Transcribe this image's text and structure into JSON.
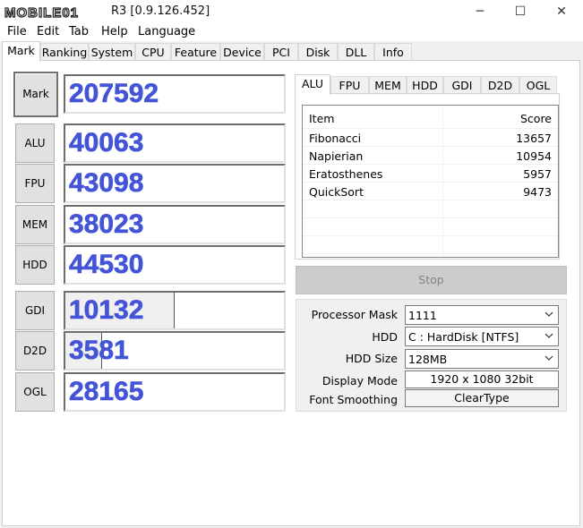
{
  "window": {
    "logo_text": "MOBILE01",
    "title": "R3 [0.9.126.452]",
    "minimize": "─",
    "maximize": "☐",
    "close": "✕"
  },
  "menu": [
    "File",
    "Edit",
    "Tab",
    "Help",
    "Language"
  ],
  "main_tabs": [
    "Mark",
    "Ranking",
    "System",
    "CPU",
    "Feature",
    "Device",
    "PCI",
    "Disk",
    "DLL",
    "Info"
  ],
  "active_main_tab": "Mark",
  "scores": [
    {
      "label": "Mark",
      "value": "207592"
    },
    {
      "label": "ALU",
      "value": "40063"
    },
    {
      "label": "FPU",
      "value": "43098"
    },
    {
      "label": "MEM",
      "value": "38023"
    },
    {
      "label": "HDD",
      "value": "44530"
    },
    {
      "label": "GDI",
      "value": "10132",
      "level": 0.5
    },
    {
      "label": "D2D",
      "value": "3581",
      "level": 0.17
    },
    {
      "label": "OGL",
      "value": "28165"
    }
  ],
  "sub_tabs": [
    "ALU",
    "FPU",
    "MEM",
    "HDD",
    "GDI",
    "D2D",
    "OGL"
  ],
  "active_sub_tab": "ALU",
  "results": {
    "header": {
      "item": "Item",
      "score": "Score"
    },
    "rows": [
      {
        "item": "Fibonacci",
        "score": "13657"
      },
      {
        "item": "Napierian",
        "score": "10954"
      },
      {
        "item": "Eratosthenes",
        "score": "5957"
      },
      {
        "item": "QuickSort",
        "score": "9473"
      }
    ]
  },
  "stop_button": "Stop",
  "settings": {
    "processor_mask": {
      "label": "Processor Mask",
      "value": "1111"
    },
    "hdd": {
      "label": "HDD",
      "value": "C : HardDisk [NTFS]"
    },
    "hdd_size": {
      "label": "HDD Size",
      "value": "128MB"
    },
    "display_mode": {
      "label": "Display Mode",
      "value": "1920 x 1080 32bit"
    },
    "font_smoothing": {
      "label": "Font Smoothing",
      "value": "ClearType"
    }
  },
  "colors": {
    "score_text": "#4354d6",
    "logo": "#1a1a1a"
  }
}
